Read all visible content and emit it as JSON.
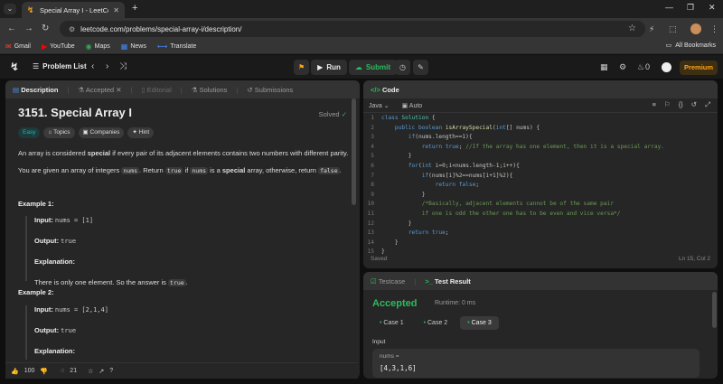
{
  "browser": {
    "tab_title": "Special Array I - LeetCode",
    "url": "leetcode.com/problems/special-array-i/description/",
    "bookmarks": [
      {
        "label": "Gmail",
        "icon": "gmail-icon"
      },
      {
        "label": "YouTube",
        "icon": "youtube-icon"
      },
      {
        "label": "Maps",
        "icon": "maps-icon"
      },
      {
        "label": "News",
        "icon": "news-icon"
      },
      {
        "label": "Translate",
        "icon": "translate-icon"
      }
    ],
    "all_bookmarks": "All Bookmarks"
  },
  "topbar": {
    "problem_list": "Problem List",
    "run": "Run",
    "submit": "Submit",
    "notifications": "0",
    "premium": "Premium"
  },
  "left_tabs": {
    "description": "Description",
    "accepted": "Accepted",
    "editorial": "Editorial",
    "solutions": "Solutions",
    "submissions": "Submissions"
  },
  "problem": {
    "title": "3151. Special Array I",
    "solved": "Solved",
    "tags": [
      "Easy",
      "Topics",
      "Companies",
      "Hint"
    ],
    "para1_a": "An array is considered ",
    "para1_b": "special",
    "para1_c": " if every pair of its adjacent elements contains two numbers with different parity.",
    "para2_a": "You are given an array of integers ",
    "para2_b": "nums",
    "para2_c": ". Return ",
    "para2_d": "true",
    "para2_e": " if ",
    "para2_f": "nums",
    "para2_g": " is a ",
    "para2_h": "special",
    "para2_i": " array, otherwise, return ",
    "para2_j": "false",
    "para2_k": "."
  },
  "examples": [
    {
      "heading": "Example 1:",
      "input_label": "Input:",
      "input": "nums = [1]",
      "output_label": "Output:",
      "output": "true",
      "explanation_label": "Explanation:",
      "explanation_a": "There is only one element. So the answer is ",
      "explanation_b": "true",
      "explanation_c": "."
    },
    {
      "heading": "Example 2:",
      "input_label": "Input:",
      "input": "nums = [2,1,4]",
      "output_label": "Output:",
      "output": "true",
      "explanation_label": "Explanation:"
    }
  ],
  "left_footer": {
    "likes": "100",
    "comments": "21"
  },
  "code_panel": {
    "title": "Code",
    "language": "Java",
    "mode": "Auto",
    "status": "Saved",
    "cursor": "Ln 15, Col 2"
  },
  "test_panel": {
    "testcase_tab": "Testcase",
    "result_tab": "Test Result",
    "verdict": "Accepted",
    "runtime": "Runtime: 0 ms",
    "cases": [
      "Case 1",
      "Case 2",
      "Case 3"
    ],
    "input_label": "Input",
    "var_name": "nums =",
    "var_value": "[4,3,1,6]"
  }
}
